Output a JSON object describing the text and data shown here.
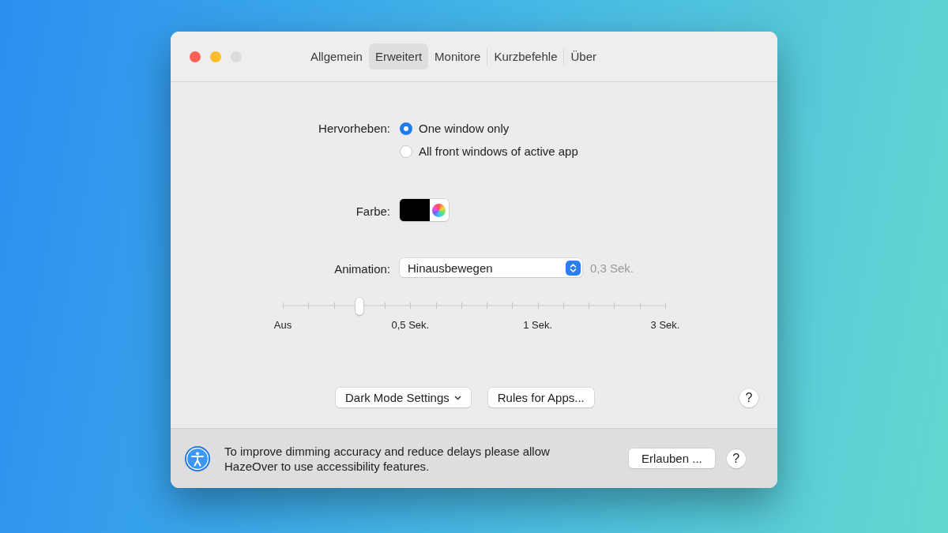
{
  "tabs": [
    {
      "label": "Allgemein",
      "selected": false
    },
    {
      "label": "Erweitert",
      "selected": true
    },
    {
      "label": "Monitore",
      "selected": false
    },
    {
      "label": "Kurzbefehle",
      "selected": false
    },
    {
      "label": "Über",
      "selected": false
    }
  ],
  "highlight": {
    "label": "Hervorheben:",
    "options": [
      {
        "label": "One window only",
        "selected": true
      },
      {
        "label": "All front windows of active app",
        "selected": false
      }
    ]
  },
  "color": {
    "label": "Farbe:",
    "color": "#000000"
  },
  "animation": {
    "label": "Animation:",
    "value": "Hinausbewegen",
    "reading": "0,3 Sek.",
    "slider": {
      "level": 0.2,
      "labels": [
        "Aus",
        "0,5 Sek.",
        "1 Sek.",
        "3 Sek."
      ]
    }
  },
  "buttons": [
    {
      "label": "Dark Mode Settings",
      "kind": "menu"
    },
    {
      "label": "Rules for Apps...",
      "kind": "plain"
    }
  ],
  "help": "?",
  "footer": {
    "message": "To improve dimming accuracy and reduce delays please allow HazeOver to use accessibility features.",
    "button": "Erlauben ...",
    "help": "?"
  }
}
